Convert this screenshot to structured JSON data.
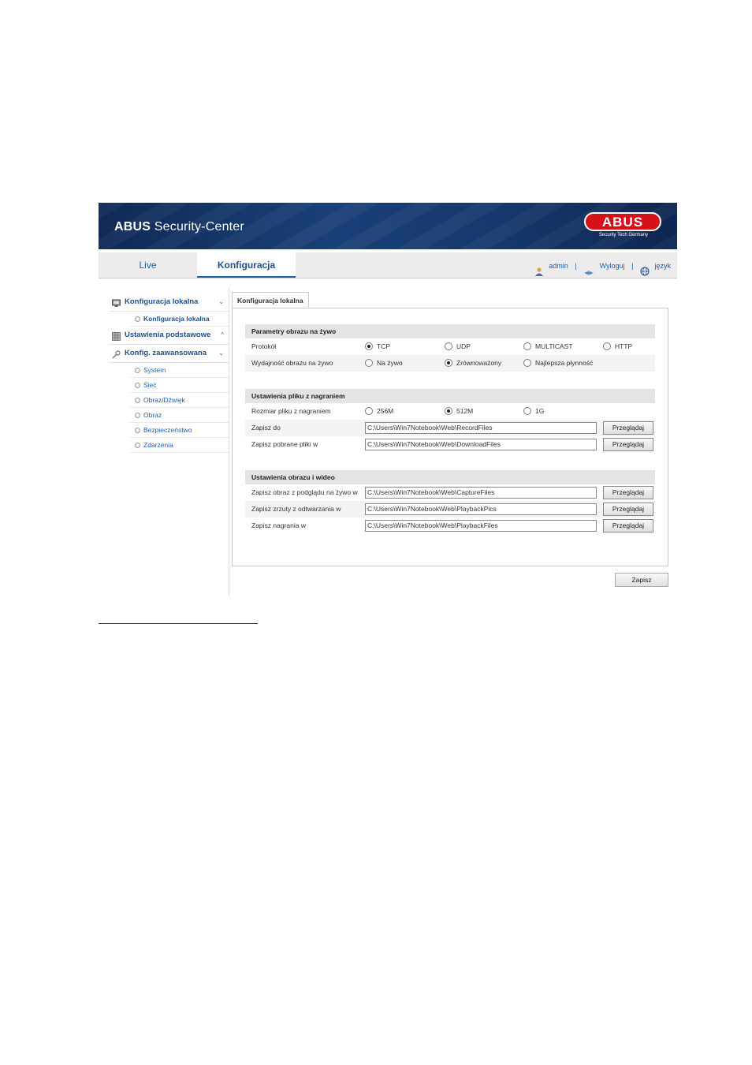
{
  "header": {
    "brand_bold": "ABUS",
    "brand_rest": " Security-Center",
    "logo_text": "ABUS",
    "logo_tagline": "Security Tech Germany"
  },
  "nav": {
    "tabs": [
      {
        "label": "Live"
      },
      {
        "label": "Konfiguracja"
      }
    ],
    "user": "admin",
    "logout": "Wyloguj",
    "language": "język",
    "separator": "|"
  },
  "sidebar": {
    "groups": [
      {
        "label": "Konfiguracja lokalna",
        "chevron": "⌄",
        "items": [
          {
            "label": "Konfiguracja lokalna"
          }
        ]
      },
      {
        "label": "Ustawienia podstawowe",
        "chevron": "^",
        "items": []
      },
      {
        "label": "Konfig. zaawansowana",
        "chevron": "⌄",
        "items": [
          {
            "label": "System"
          },
          {
            "label": "Sieć"
          },
          {
            "label": "Obraz/Dźwięk"
          },
          {
            "label": "Obraz"
          },
          {
            "label": "Bezpieczeństwo"
          },
          {
            "label": "Zdarzenia"
          }
        ]
      }
    ]
  },
  "panel": {
    "tab_label": "Konfiguracja lokalna",
    "sections": [
      {
        "title": "Parametry obrazu na żywo",
        "rows": [
          {
            "label": "Protokół",
            "options": [
              "TCP",
              "UDP",
              "MULTICAST",
              "HTTP"
            ],
            "selected": "TCP"
          },
          {
            "label": "Wydajność obrazu na żywo",
            "options": [
              "Na żywo",
              "Zrównoważony",
              "Najlepsza płynność"
            ],
            "selected": "Zrównoważony"
          }
        ]
      },
      {
        "title": "Ustawienia pliku z nagraniem",
        "rows": [
          {
            "label": "Rozmiar pliku z nagraniem",
            "options": [
              "256M",
              "512M",
              "1G"
            ],
            "selected": "512M"
          },
          {
            "label": "Zapisz do",
            "path": "C:\\Users\\Win7Notebook\\Web\\RecordFiles",
            "button": "Przeglądaj"
          },
          {
            "label": "Zapisz pobrane pliki w",
            "path": "C:\\Users\\Win7Notebook\\Web\\DownloadFiles",
            "button": "Przeglądaj"
          }
        ]
      },
      {
        "title": "Ustawienia obrazu i wideo",
        "rows": [
          {
            "label": "Zapisz obraz z podglądu na żywo w",
            "path": "C:\\Users\\Win7Notebook\\Web\\CaptureFiles",
            "button": "Przeglądaj"
          },
          {
            "label": "Zapisz zrzuty z odtwarzania w",
            "path": "C:\\Users\\Win7Notebook\\Web\\PlaybackPics",
            "button": "Przeglądaj"
          },
          {
            "label": "Zapisz nagrania w",
            "path": "C:\\Users\\Win7Notebook\\Web\\PlaybackFiles",
            "button": "Przeglądaj"
          }
        ]
      }
    ],
    "save_label": "Zapisz"
  },
  "colors": {
    "accent": "#1f5fae",
    "banner": "#16386c",
    "logo_red": "#d6111a"
  }
}
